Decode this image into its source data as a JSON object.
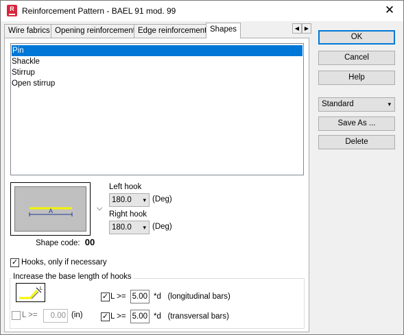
{
  "window": {
    "title": "Reinforcement Pattern - BAEL 91 mod. 99",
    "icon": "app-logo-icon",
    "close": "✕"
  },
  "tabs": [
    {
      "label": "Wire fabrics"
    },
    {
      "label": "Opening reinforcement"
    },
    {
      "label": "Edge reinforcement"
    },
    {
      "label": "Shapes",
      "active": true
    }
  ],
  "tab_scroll": {
    "left": "◀",
    "right": "▶"
  },
  "shapes_list": [
    "Pin",
    "Shackle",
    "Stirrup",
    "Open stirrup"
  ],
  "selected_shape": "Pin",
  "preview": {
    "dimension_label": "A",
    "bar_color": "#f5f500"
  },
  "shape_code": {
    "label": "Shape code:",
    "value": "00"
  },
  "left_hook": {
    "label": "Left hook",
    "value": "180.0",
    "unit": "(Deg)"
  },
  "right_hook": {
    "label": "Right hook",
    "value": "180.0",
    "unit": "(Deg)"
  },
  "hooks_if_necessary": {
    "label": "Hooks, only if necessary",
    "checked": true
  },
  "increase_group": {
    "title": "Increase the base length of hooks",
    "abs_label": "L >=",
    "abs_value": "0.00",
    "abs_unit": "(in)",
    "abs_checked": false,
    "long_label": "L >=",
    "long_value": "5.00",
    "long_unit": "*d   (longitudinal bars)",
    "long_checked": true,
    "trans_label": "L >=",
    "trans_value": "5.00",
    "trans_unit": "*d   (transversal bars)",
    "trans_checked": true
  },
  "buttons": {
    "ok": "OK",
    "cancel": "Cancel",
    "help": "Help",
    "save_as": "Save As ...",
    "delete": "Delete"
  },
  "standard_select": "Standard",
  "colors": {
    "selection": "#0078d7",
    "default_border": "#0078d7"
  }
}
